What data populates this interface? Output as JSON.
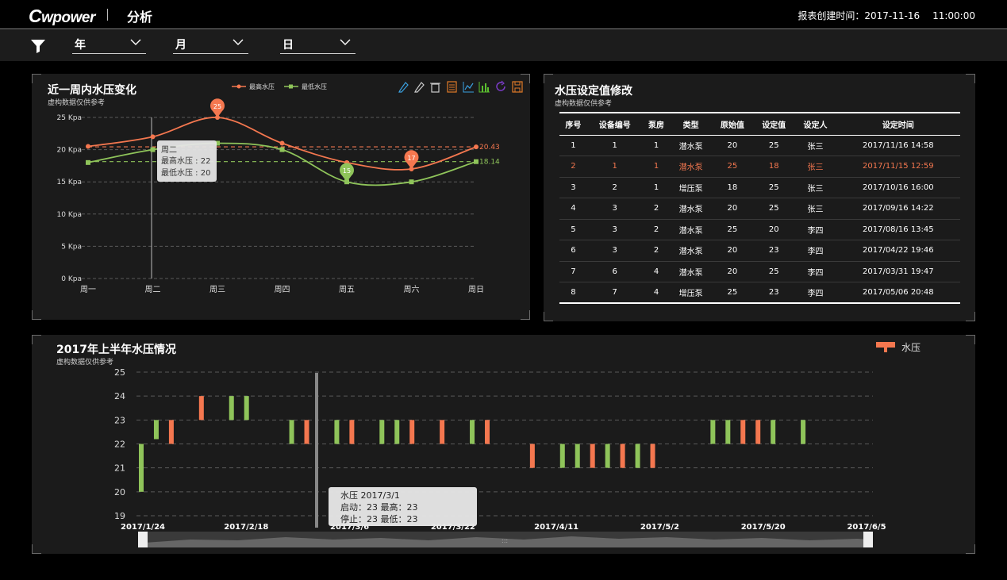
{
  "header": {
    "logo_text": "wpower",
    "title": "分析",
    "report_time_label": "报表创建时间：",
    "report_date": "2017-11-16",
    "report_clock": "11:00:00"
  },
  "filters": [
    {
      "label": "年"
    },
    {
      "label": "月"
    },
    {
      "label": "日"
    }
  ],
  "colors": {
    "max_series": "#f4774f",
    "min_series": "#8fc45a",
    "panel_bg": "#1b1b1b"
  },
  "weekly": {
    "title": "近一周内水压变化",
    "subtitle": "虚构数据仅供参考",
    "legend_max": "最高水压",
    "legend_min": "最低水压",
    "tooltip": {
      "day": "周二",
      "line1": "最高水压 : 22",
      "line2": "最低水压 : 20"
    },
    "toolbox_icons": [
      "mark-pen-icon",
      "edit-icon",
      "delete-icon",
      "data-view-icon",
      "line-chart-icon",
      "bar-chart-icon",
      "restore-icon",
      "save-image-icon"
    ]
  },
  "table": {
    "title": "水压设定值修改",
    "subtitle": "虚构数据仅供参考",
    "columns": [
      "序号",
      "设备编号",
      "泵房",
      "类型",
      "原始值",
      "设定值",
      "设定人",
      "设定时间"
    ],
    "rows": [
      [
        "1",
        "1",
        "1",
        "潜水泵",
        "20",
        "25",
        "张三",
        "2017/11/16  14:58"
      ],
      [
        "2",
        "1",
        "1",
        "潜水泵",
        "25",
        "18",
        "张三",
        "2017/11/15  12:59"
      ],
      [
        "3",
        "2",
        "1",
        "增压泵",
        "18",
        "25",
        "张三",
        "2017/10/16  16:00"
      ],
      [
        "4",
        "3",
        "2",
        "潜水泵",
        "20",
        "25",
        "张三",
        "2017/09/16  14:22"
      ],
      [
        "5",
        "3",
        "2",
        "潜水泵",
        "25",
        "20",
        "李四",
        "2017/08/16  13:45"
      ],
      [
        "6",
        "3",
        "2",
        "潜水泵",
        "20",
        "23",
        "李四",
        "2017/04/22  19:46"
      ],
      [
        "7",
        "6",
        "4",
        "潜水泵",
        "20",
        "25",
        "李四",
        "2017/03/31  19:47"
      ],
      [
        "8",
        "7",
        "4",
        "增压泵",
        "25",
        "23",
        "李四",
        "2017/05/06  20:48"
      ]
    ],
    "highlight_row": 1
  },
  "half_year": {
    "title": "2017年上半年水压情况",
    "subtitle": "虚构数据仅供参考",
    "legend": "水压",
    "tooltip": {
      "line1": "水压  2017/3/1",
      "line2": "启动：23    最高：23",
      "line3": "停止：23    最低：23"
    }
  },
  "chart_data": [
    {
      "type": "line",
      "categories": [
        "周一",
        "周二",
        "周三",
        "周四",
        "周五",
        "周六",
        "周日"
      ],
      "ylim": [
        0,
        25
      ],
      "y_ticks": [
        0,
        5,
        10,
        15,
        20,
        25
      ],
      "y_tick_labels": [
        "0 Kpa",
        "5 Kpa",
        "10 Kpa",
        "15 Kpa",
        "20 Kpa",
        "25 Kpa"
      ],
      "series": [
        {
          "name": "最高水压",
          "values": [
            20.5,
            22,
            25,
            21,
            18,
            17,
            20.43
          ],
          "max_point": 25,
          "min_point": 17,
          "average": 20.43
        },
        {
          "name": "最低水压",
          "values": [
            18,
            20,
            21,
            20,
            15,
            15,
            18.14
          ],
          "max_point": 21,
          "min_point": 15,
          "average": 18.14
        }
      ],
      "average_labels": [
        "20.43",
        "18.14"
      ],
      "pin_labels": [
        "25",
        "17",
        "15"
      ],
      "grid": true,
      "legend": "top-center"
    },
    {
      "type": "candlestick",
      "ylim": [
        19,
        25
      ],
      "y_ticks": [
        19,
        20,
        21,
        22,
        23,
        24,
        25
      ],
      "x_tick_labels": [
        "2017/1/24",
        "2017/2/18",
        "2017/3/6",
        "2017/3/22",
        "2017/4/11",
        "2017/5/2",
        "2017/5/20",
        "2017/6/5"
      ],
      "legend": "top-right",
      "grid": true,
      "candles": [
        {
          "i": 0,
          "open": 20,
          "close": 22,
          "up": true
        },
        {
          "i": 1,
          "open": 22.2,
          "close": 23,
          "up": true
        },
        {
          "i": 2,
          "open": 22,
          "close": 23,
          "up": false
        },
        {
          "i": 4,
          "open": 23,
          "close": 24,
          "up": false
        },
        {
          "i": 6,
          "open": 23,
          "close": 24,
          "up": true
        },
        {
          "i": 7,
          "open": 23,
          "close": 24,
          "up": true
        },
        {
          "i": 10,
          "open": 22,
          "close": 23,
          "up": true
        },
        {
          "i": 11,
          "open": 22,
          "close": 23,
          "up": false
        },
        {
          "i": 13,
          "open": 22,
          "close": 23,
          "up": true
        },
        {
          "i": 14,
          "open": 22,
          "close": 23,
          "up": false
        },
        {
          "i": 16,
          "open": 22,
          "close": 23,
          "up": true
        },
        {
          "i": 17,
          "open": 22,
          "close": 23,
          "up": true
        },
        {
          "i": 18,
          "open": 22,
          "close": 23,
          "up": false
        },
        {
          "i": 20,
          "open": 22,
          "close": 23,
          "up": false
        },
        {
          "i": 22,
          "open": 22,
          "close": 23,
          "up": true
        },
        {
          "i": 23,
          "open": 22,
          "close": 23,
          "up": false
        },
        {
          "i": 26,
          "open": 21,
          "close": 22,
          "up": false
        },
        {
          "i": 28,
          "open": 21,
          "close": 22,
          "up": true
        },
        {
          "i": 29,
          "open": 21,
          "close": 22,
          "up": true
        },
        {
          "i": 30,
          "open": 21,
          "close": 22,
          "up": false
        },
        {
          "i": 31,
          "open": 21,
          "close": 22,
          "up": true
        },
        {
          "i": 32,
          "open": 21,
          "close": 22,
          "up": false
        },
        {
          "i": 33,
          "open": 21,
          "close": 22,
          "up": true
        },
        {
          "i": 34,
          "open": 21,
          "close": 22,
          "up": false
        },
        {
          "i": 38,
          "open": 22,
          "close": 23,
          "up": true
        },
        {
          "i": 39,
          "open": 22,
          "close": 23,
          "up": true
        },
        {
          "i": 40,
          "open": 22,
          "close": 23,
          "up": false
        },
        {
          "i": 41,
          "open": 22,
          "close": 23,
          "up": false
        },
        {
          "i": 42,
          "open": 22,
          "close": 23,
          "up": true
        },
        {
          "i": 44,
          "open": 22,
          "close": 23,
          "up": true
        }
      ]
    }
  ]
}
